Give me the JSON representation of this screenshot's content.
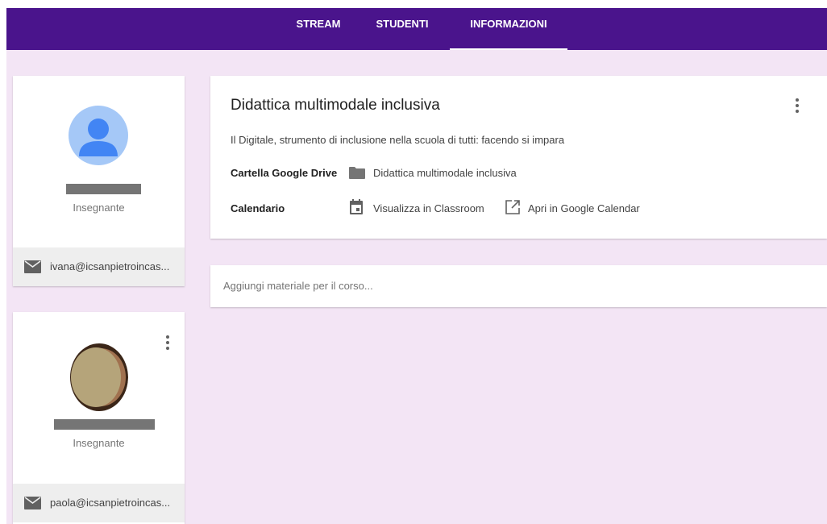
{
  "nav": {
    "tabs": [
      {
        "label": "STREAM",
        "active": false
      },
      {
        "label": "STUDENTI",
        "active": false
      },
      {
        "label": "INFORMAZIONI",
        "active": true
      }
    ]
  },
  "teachers": [
    {
      "role": "Insegnante",
      "email": "ivana@icsanpietroincas...",
      "avatar": "default-person-icon"
    },
    {
      "role": "Insegnante",
      "email": "paola@icsanpietroincas...",
      "avatar": "photo"
    }
  ],
  "course": {
    "title": "Didattica multimodale inclusiva",
    "description": "Il Digitale, strumento di inclusione nella scuola di tutti: facendo si impara",
    "drive_label": "Cartella Google Drive",
    "drive_folder": "Didattica multimodale inclusiva",
    "calendar_label": "Calendario",
    "calendar_view": "Visualizza in Classroom",
    "calendar_open": "Apri in Google Calendar"
  },
  "materials": {
    "placeholder": "Aggiungi materiale per il corso..."
  },
  "colors": {
    "header": "#4a148c",
    "background": "#f3e5f5",
    "avatar_bg": "#a5c8f7",
    "avatar_person": "#4285f4"
  }
}
